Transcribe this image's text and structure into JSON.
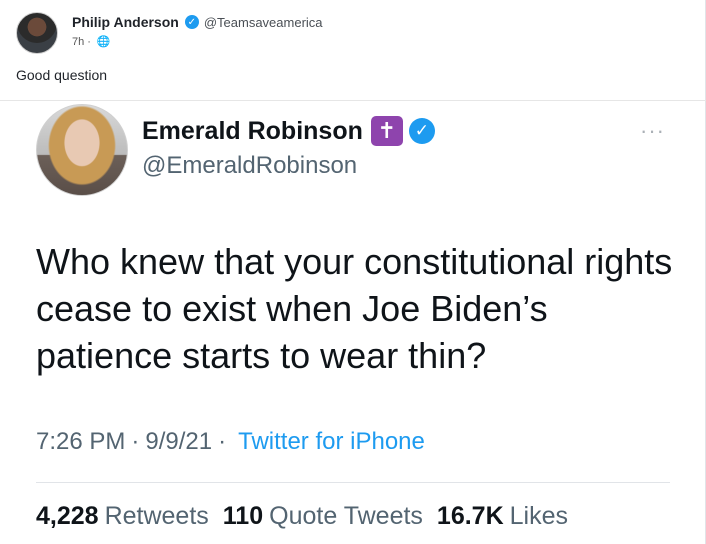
{
  "outer_post": {
    "author_name": "Philip Anderson",
    "author_handle": "@Teamsaveamerica",
    "time": "7h",
    "separator": "·",
    "text": "Good question"
  },
  "tweet": {
    "author_name": "Emerald Robinson",
    "badge_symbol": "✝",
    "author_handle": "@EmeraldRobinson",
    "more_symbol": "···",
    "text": "Who knew that your constitutional rights cease to exist when Joe Biden’s patience starts to wear thin?",
    "time": "7:26 PM",
    "date": "9/9/21",
    "separator": "·",
    "source": "Twitter for iPhone",
    "stats": {
      "retweets_count": "4,228",
      "retweets_label": "Retweets",
      "quotes_count": "110",
      "quotes_label": "Quote Tweets",
      "likes_count": "16.7K",
      "likes_label": "Likes"
    }
  },
  "colors": {
    "accent": "#1d9bf0",
    "badge": "#8e44ad",
    "muted": "#536471"
  }
}
